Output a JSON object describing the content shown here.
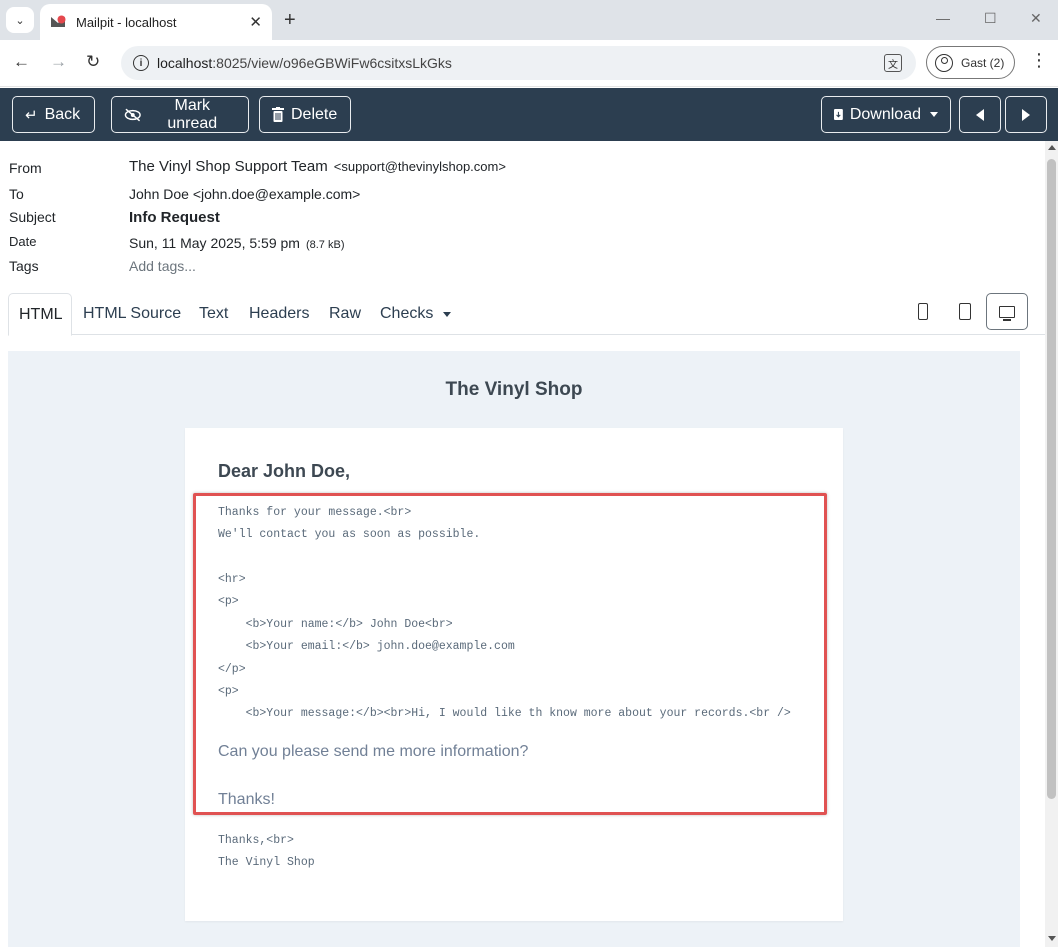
{
  "browser": {
    "tab_title": "Mailpit - localhost",
    "url_host": "localhost",
    "url_path": ":8025/view/o96eGBWiFw6csitxsLkGks",
    "profile_label": "Gast (2)"
  },
  "header": {
    "back_label": "Back",
    "mark_unread_label": "Mark unread",
    "delete_label": "Delete",
    "download_label": "Download"
  },
  "message": {
    "from_label": "From",
    "from_name": "The Vinyl Shop Support Team",
    "from_email": "<support@thevinylshop.com>",
    "to_label": "To",
    "to_value": "John Doe <john.doe@example.com>",
    "subject_label": "Subject",
    "subject_value": "Info Request",
    "date_label": "Date",
    "date_value": "Sun, 11 May 2025, 5:59 pm",
    "size_value": "(8.7 kB)",
    "tags_label": "Tags",
    "tags_placeholder": "Add tags..."
  },
  "tabs": {
    "html": "HTML",
    "html_source": "HTML Source",
    "text": "Text",
    "headers": "Headers",
    "raw": "Raw",
    "checks": "Checks"
  },
  "preview": {
    "shop_title": "The Vinyl Shop",
    "greeting": "Dear John Doe,",
    "code_lines": [
      "Thanks for your message.<br>",
      "We'll contact you as soon as possible.",
      "<hr>",
      "<p>",
      "    <b>Your name:</b> John Doe<br>",
      "    <b>Your email:</b> john.doe@example.com",
      "</p>",
      "<p>",
      "    <b>Your message:</b><br>Hi, I would like th know more about your records.<br />"
    ],
    "message_line_1": "Can you please send me more information?",
    "message_line_2": "Thanks!",
    "footer_lines": [
      "Thanks,<br>",
      "The Vinyl Shop"
    ]
  },
  "colors": {
    "header_bg": "#2c3e50",
    "preview_bg": "#edf2f7",
    "highlight_border": "#e05252"
  }
}
